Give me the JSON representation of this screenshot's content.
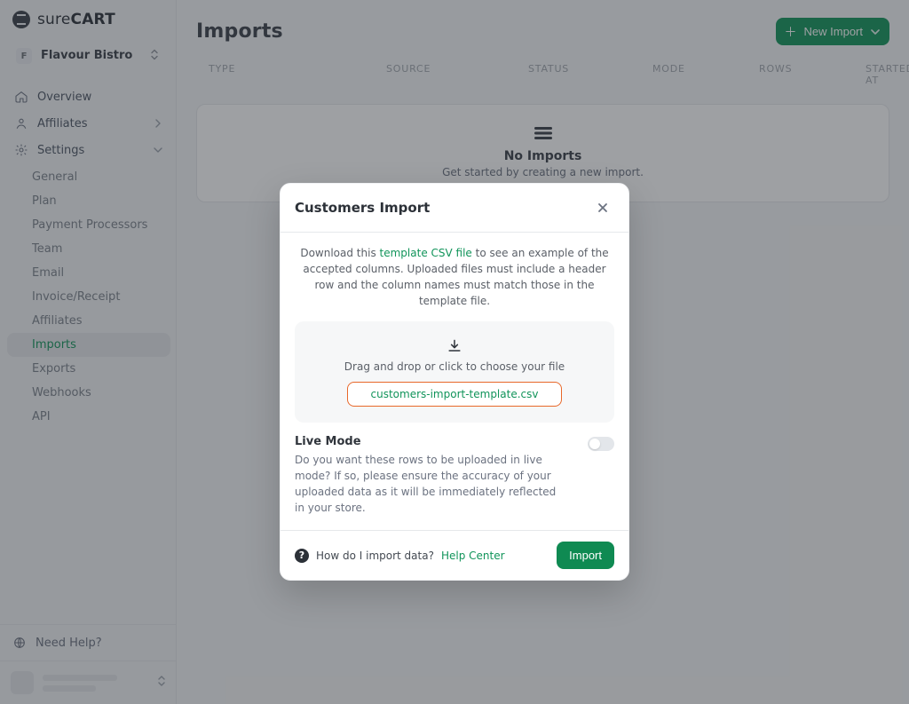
{
  "brand": {
    "prefix": "sure",
    "bold": "CART"
  },
  "org": {
    "initial": "F",
    "name": "Flavour Bistro"
  },
  "nav": {
    "overview": "Overview",
    "affiliatesTop": "Affiliates",
    "settings": "Settings",
    "sub": {
      "general": "General",
      "plan": "Plan",
      "payment": "Payment Processors",
      "team": "Team",
      "email": "Email",
      "invoice": "Invoice/Receipt",
      "affiliates": "Affiliates",
      "imports": "Imports",
      "exports": "Exports",
      "webhooks": "Webhooks",
      "api": "API"
    }
  },
  "footer": {
    "need_help": "Need Help?"
  },
  "page": {
    "title": "Imports",
    "new_button": "New Import"
  },
  "columns": {
    "type": "Type",
    "source": "Source",
    "status": "Status",
    "mode": "Mode",
    "rows": "Rows",
    "started": "Started At"
  },
  "empty": {
    "title": "No Imports",
    "sub": "Get started by creating a new import."
  },
  "modal": {
    "title": "Customers Import",
    "desc_prefix": "Download this ",
    "template_link_label": "template CSV file",
    "desc_suffix": " to see an example of the accepted columns. Uploaded files must include a header row and the column names must match those in the template file.",
    "drop_text": "Drag and drop or click to choose your file",
    "file_name": "customers-import-template.csv",
    "live_title": "Live Mode",
    "live_desc": "Do you want these rows to be uploaded in live mode? If so, please ensure the accuracy of your uploaded data as it will be immediately reflected in your store.",
    "help_question": "How do I import data?",
    "help_link_label": "Help Center",
    "import_btn": "Import"
  },
  "colors": {
    "accent": "#11945a",
    "orange": "#e8682a"
  }
}
